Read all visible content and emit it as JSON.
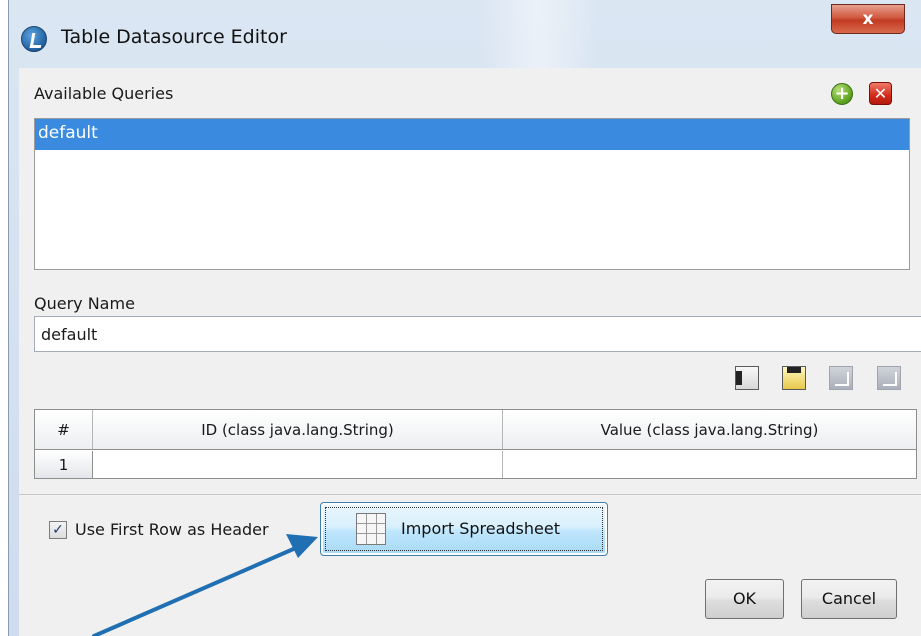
{
  "window": {
    "title": "Table Datasource Editor",
    "close_label": "x"
  },
  "queries": {
    "section_label": "Available Queries",
    "add_icon": "add-icon",
    "remove_icon": "remove-icon",
    "items": [
      "default"
    ],
    "selected_index": 0
  },
  "query_name": {
    "label": "Query Name",
    "value": "default"
  },
  "grid": {
    "columns": [
      "#",
      "ID (class java.lang.String)",
      "Value (class java.lang.String)"
    ],
    "rows": [
      {
        "index": "1",
        "id": "",
        "value": ""
      }
    ],
    "toolbar_icons": [
      "insert-column-icon",
      "insert-row-icon",
      "delete-column-icon",
      "delete-row-icon"
    ]
  },
  "footer": {
    "use_first_row_label": "Use First Row as Header",
    "use_first_row_checked": true,
    "checkbox_mark": "✓",
    "import_label": "Import Spreadsheet",
    "ok_label": "OK",
    "cancel_label": "Cancel"
  },
  "colors": {
    "selection": "#3a8be0",
    "client_bg": "#f0f0f0",
    "annotation_arrow": "#1f6fb2"
  }
}
